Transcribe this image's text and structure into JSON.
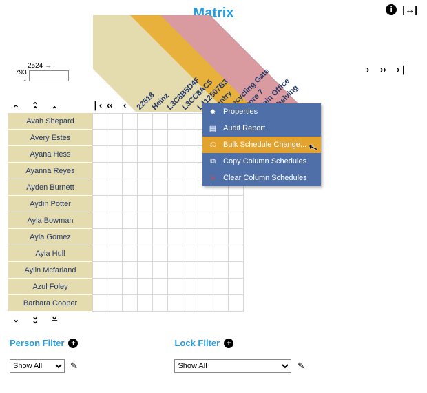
{
  "title": "Matrix",
  "coords": {
    "col": "2524",
    "row": "793",
    "input_value": ""
  },
  "columns": [
    {
      "label": "22518",
      "color": "#e4dbae"
    },
    {
      "label": "Heinz",
      "color": "#e4dbae"
    },
    {
      "label": "L3C8B5D4F",
      "color": "#e4dbae"
    },
    {
      "label": "L3CC8AC5",
      "color": "#e4dbae"
    },
    {
      "label": "L412507B3",
      "color": "#e4dbae"
    },
    {
      "label": "Pantry",
      "color": "#e4dbae"
    },
    {
      "label": "Recycling Gate",
      "color": "#e8b13c"
    },
    {
      "label": "Store 7",
      "color": "#e8b13c"
    },
    {
      "label": "Main Office",
      "color": "#d99aa0"
    },
    {
      "label": "Shelving",
      "color": "#d99aa0"
    },
    {
      "label": "",
      "color": "#d99aa0"
    }
  ],
  "rows": [
    "Avah Shepard",
    "Avery Estes",
    "Ayana Hess",
    "Ayanna Reyes",
    "Ayden Burnett",
    "Aydin Potter",
    "Ayla Bowman",
    "Ayla Gomez",
    "Ayla Hull",
    "Aylin Mcfarland",
    "Azul Foley",
    "Barbara Cooper"
  ],
  "grid_cols": 10,
  "context_menu": {
    "items": [
      {
        "icon": "✸",
        "label": "Properties"
      },
      {
        "icon": "▤",
        "label": "Audit Report"
      },
      {
        "icon": "⎌",
        "label": "Bulk Schedule Change...",
        "highlight": true
      },
      {
        "icon": "⧉",
        "label": "Copy Column Schedules"
      },
      {
        "icon": "✕",
        "label": "Clear Column Schedules",
        "icon_color": "#c05050"
      }
    ]
  },
  "filters": {
    "person": {
      "title": "Person Filter",
      "select": "Show All",
      "select_width": 80
    },
    "lock": {
      "title": "Lock Filter",
      "select": "Show All",
      "select_width": 170
    }
  }
}
